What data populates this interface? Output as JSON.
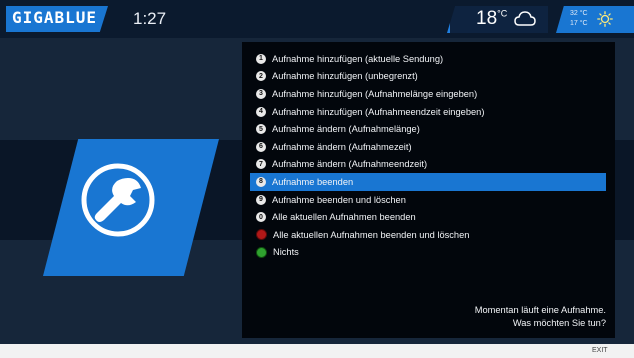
{
  "header": {
    "brand": "GIGABLUE",
    "time": "1:27",
    "temperature": "18",
    "temperature_unit": "°C",
    "forecast_high": "32 °C",
    "forecast_low": "17 °C",
    "current_weather_icon": "cloud-icon",
    "forecast_weather_icon": "sun-icon"
  },
  "left_panel": {
    "icon": "wrench-icon"
  },
  "menu": {
    "items": [
      {
        "key": "1",
        "label": "Aufnahme hinzufügen (aktuelle Sendung)"
      },
      {
        "key": "2",
        "label": "Aufnahme hinzufügen (unbegrenzt)"
      },
      {
        "key": "3",
        "label": "Aufnahme hinzufügen (Aufnahmelänge eingeben)"
      },
      {
        "key": "4",
        "label": "Aufnahme hinzufügen (Aufnahmeendzeit eingeben)"
      },
      {
        "key": "5",
        "label": "Aufnahme ändern (Aufnahmelänge)"
      },
      {
        "key": "6",
        "label": "Aufnahme ändern (Aufnahmezeit)"
      },
      {
        "key": "7",
        "label": "Aufnahme ändern (Aufnahmeendzeit)"
      },
      {
        "key": "8",
        "label": "Aufnahme beenden"
      },
      {
        "key": "9",
        "label": "Aufnahme beenden und löschen"
      },
      {
        "key": "0",
        "label": "Alle aktuellen Aufnahmen beenden"
      },
      {
        "key": "",
        "label": "Alle aktuellen Aufnahmen beenden und löschen"
      },
      {
        "key": "",
        "label": "Nichts"
      }
    ],
    "selected_index": 7
  },
  "message": {
    "line1": "Momentan läuft eine Aufnahme.",
    "line2": "Was möchten Sie tun?"
  },
  "footer": {
    "exit_label": "EXIT"
  },
  "colors": {
    "accent": "#1976d2",
    "background": "#16263a",
    "panel": "#02060c",
    "red_button": "#b01818",
    "green_button": "#2fa12f"
  }
}
